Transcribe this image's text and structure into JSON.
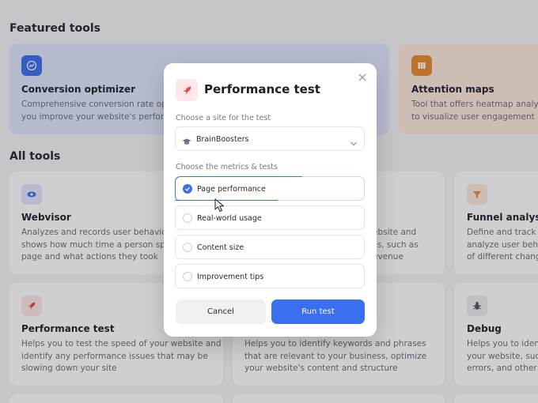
{
  "sections": {
    "featured_title": "Featured tools",
    "all_title": "All tools"
  },
  "featured": [
    {
      "title": "Conversion optimizer",
      "desc": "Comprehensive conversion rate optim\nyou improve your website's performa",
      "icon": "chart-up-icon",
      "color": "#3a6ff0"
    },
    {
      "title": "Attention maps",
      "desc": "Tool that offers heatmap analysis\nto visualize user engagement and",
      "icon": "columns-icon",
      "color": "#e8892f"
    }
  ],
  "tools": [
    {
      "title": "Webvisor",
      "desc": "Analyzes and records user behavior on\nshows how much time a person spent\npage and what actions they took",
      "icon": "eye-icon",
      "color": "#3a6ff0"
    },
    {
      "title": "",
      "desc": "ebsite and\ncs, such as\nevenue",
      "icon": "",
      "color": ""
    },
    {
      "title": "Funnel analysis",
      "desc": "Define and track yo\nanalyze user behavi\nof different change",
      "icon": "funnel-icon",
      "color": "#e8892f"
    },
    {
      "title": "Performance test",
      "desc": "Helps you to test the speed of your website and\nidentify any performance issues that may be\nslowing down your site",
      "icon": "rocket-icon",
      "color": "#e04848"
    },
    {
      "title": "",
      "desc": "Helps you to identify keywords and phrases\nthat are relevant to your business, optimize\nyour website's content and structure",
      "icon": "",
      "color": ""
    },
    {
      "title": "Debug",
      "desc": "Helps you to identi\nyour website, such\nerrors, and other w",
      "icon": "bug-icon",
      "color": "#55555f"
    }
  ],
  "modal": {
    "title": "Performance test",
    "site_label": "Choose a site for the test",
    "site_value": "BrainBoosters",
    "metrics_label": "Choose the metrics & tests",
    "options": [
      {
        "label": "Page performance",
        "checked": true
      },
      {
        "label": "Real-world usage",
        "checked": false
      },
      {
        "label": "Content size",
        "checked": false
      },
      {
        "label": "Improvement tips",
        "checked": false
      }
    ],
    "cancel_label": "Cancel",
    "run_label": "Run test"
  },
  "colors": {
    "accent": "#3a6ff0",
    "rocket": "#e04848"
  }
}
